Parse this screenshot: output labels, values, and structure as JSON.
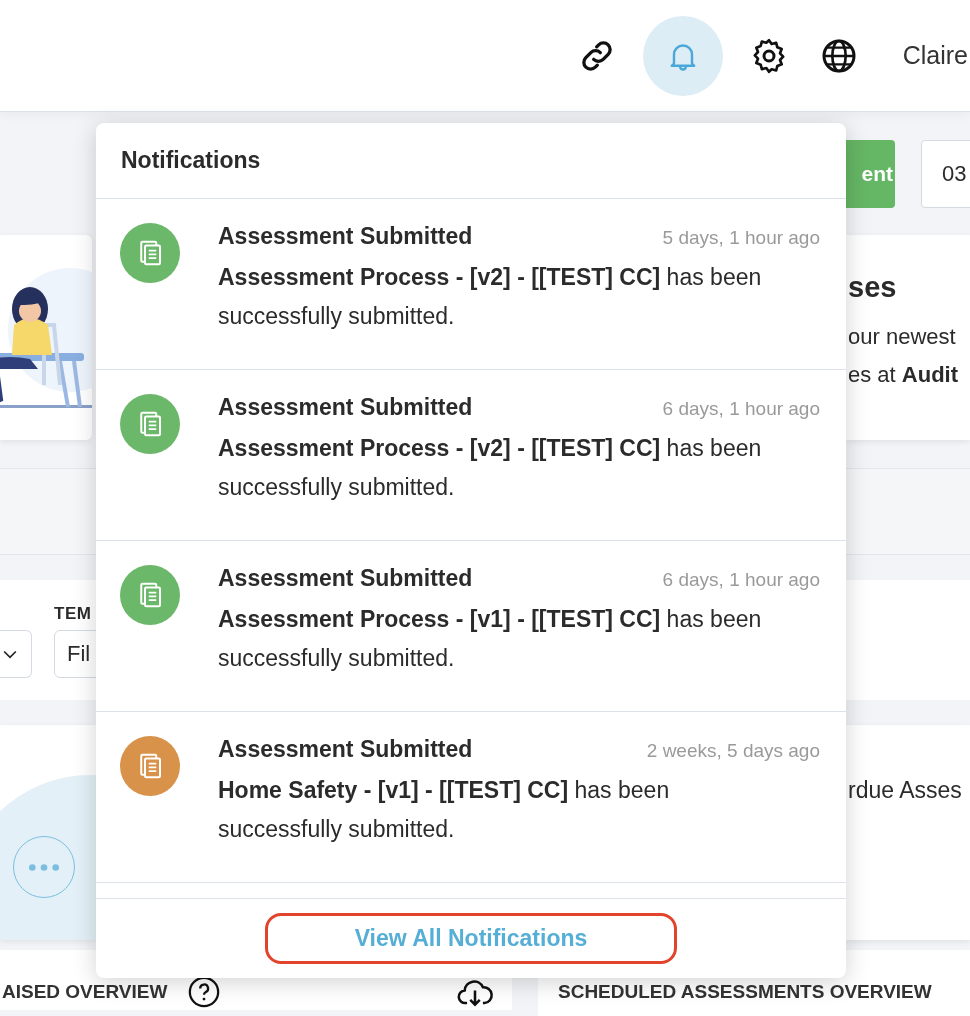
{
  "header": {
    "bell_selected": true,
    "user_name": "Claire"
  },
  "toolbar": {
    "button": "ent",
    "date": "03"
  },
  "welcome_card": {
    "heading": "ses",
    "line_1": "our newest",
    "line_2": "es at **Audit**"
  },
  "filters": {
    "label": "TEM",
    "value": "Fil"
  },
  "overdue_card": {
    "label": "rdue Asses"
  },
  "panels": [
    "AISED OVERVIEW",
    "SCHEDULED ASSESSMENTS OVERVIEW"
  ],
  "notifications": {
    "title": "Notifications",
    "items": [
      {
        "title": "Assessment Submitted",
        "time": "5 days, 1 hour ago",
        "message": "**Assessment Process - [v2] - [[TEST] CC]** has been successfully submitted.",
        "color": "#6cb86a"
      },
      {
        "title": "Assessment Submitted",
        "time": "6 days, 1 hour ago",
        "message": "**Assessment Process - [v2] - [[TEST] CC]** has been successfully submitted.",
        "color": "#6cb86a"
      },
      {
        "title": "Assessment Submitted",
        "time": "6 days, 1 hour ago",
        "message": "**Assessment Process - [v1] - [[TEST] CC]** has been successfully submitted.",
        "color": "#6cb86a"
      },
      {
        "title": "Assessment Submitted",
        "time": "2 weeks, 5 days ago",
        "message": "**Home Safety - [v1] - [[TEST] CC]** has been successfully submitted.",
        "color": "#d9924a"
      }
    ],
    "view_all": "View All Notifications"
  }
}
